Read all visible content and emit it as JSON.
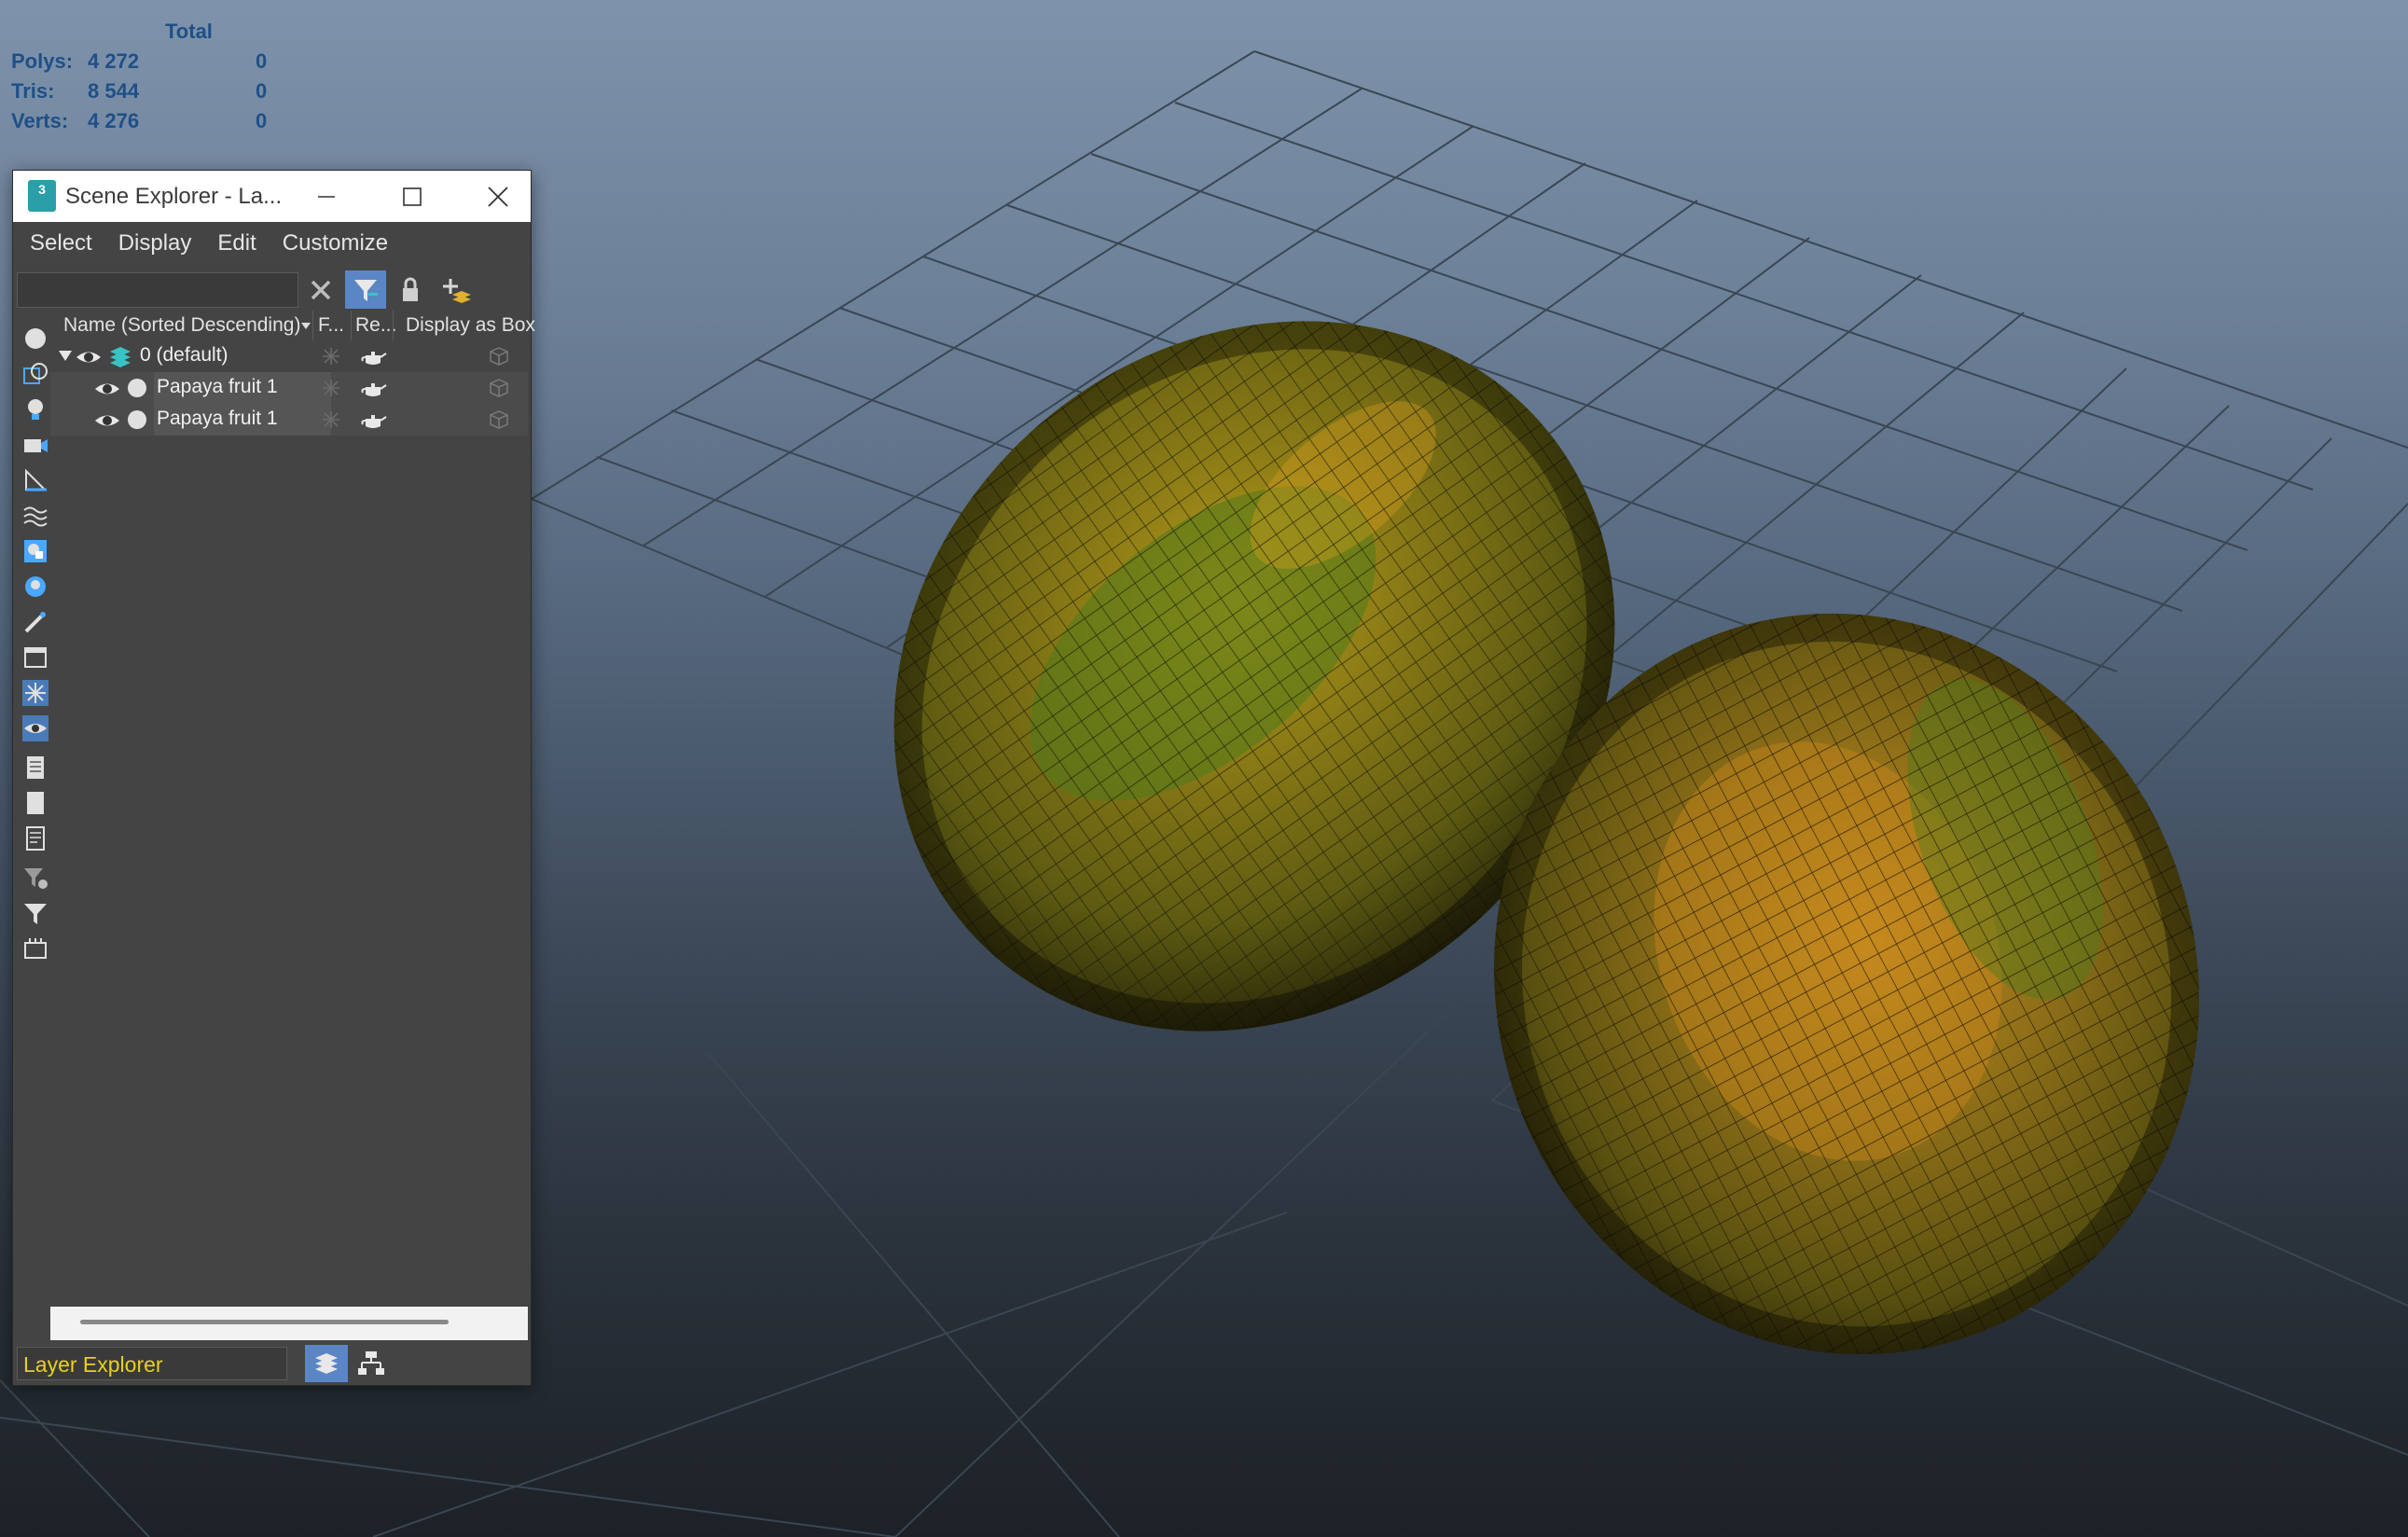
{
  "stats": {
    "header": "Total",
    "rows": [
      {
        "label": "Polys:",
        "total": "4 272",
        "selected": "0"
      },
      {
        "label": "Tris:",
        "total": "8 544",
        "selected": "0"
      },
      {
        "label": "Verts:",
        "total": "4 276",
        "selected": "0"
      }
    ]
  },
  "window": {
    "app_icon_text": "3",
    "title": "Scene Explorer - La...",
    "menu": [
      "Select",
      "Display",
      "Edit",
      "Customize"
    ],
    "search_value": ""
  },
  "columns": {
    "name": "Name (Sorted Descending)",
    "frozen": "F...",
    "render": "Re...",
    "display_as_box": "Display as Box"
  },
  "tree": [
    {
      "name": "0 (default)",
      "type": "layer"
    },
    {
      "name": "Papaya fruit 1",
      "type": "object"
    },
    {
      "name": "Papaya fruit 1",
      "type": "object"
    }
  ],
  "bottom": {
    "explorer_mode": "Layer Explorer"
  },
  "colors": {
    "accent": "#5b86c5",
    "stats_text": "#1f4f87",
    "mode_text": "#e8d020"
  }
}
